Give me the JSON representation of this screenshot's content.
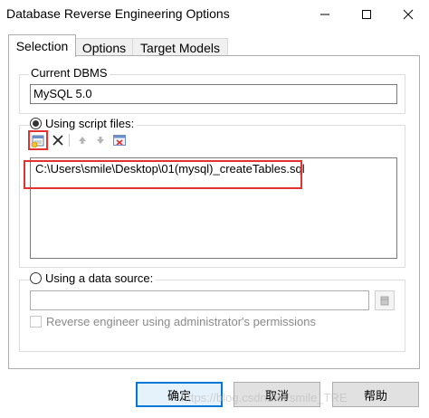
{
  "window": {
    "title": "Database Reverse Engineering Options",
    "buttons": [
      "minimize-icon",
      "maximize-icon",
      "close-icon"
    ]
  },
  "tabs": [
    {
      "label": "Selection",
      "active": true
    },
    {
      "label": "Options",
      "active": false
    },
    {
      "label": "Target Models",
      "active": false
    }
  ],
  "current_dbms": {
    "legend": "Current DBMS",
    "value": "MySQL 5.0"
  },
  "script_files": {
    "label": "Using script files:",
    "selected": true,
    "toolbar_icons": [
      "add-file-icon",
      "delete-icon",
      "move-up-icon",
      "move-down-icon",
      "clear-list-icon"
    ],
    "files": [
      "C:\\Users\\smile\\Desktop\\01(mysql)_createTables.sql"
    ]
  },
  "data_source": {
    "label": "Using a data source:",
    "selected": false,
    "value": "",
    "browse_icon": "database-icon",
    "admin_checkbox_label": "Reverse engineer using administrator's permissions",
    "admin_checked": false
  },
  "footer": {
    "ok_label": "确定",
    "cancel_label": "取消",
    "help_label": "帮助"
  },
  "watermark": "https://blog.csdn.net/smile_TRE",
  "colors": {
    "highlight_box": "#e23232",
    "default_button_border": "#0078d7"
  }
}
